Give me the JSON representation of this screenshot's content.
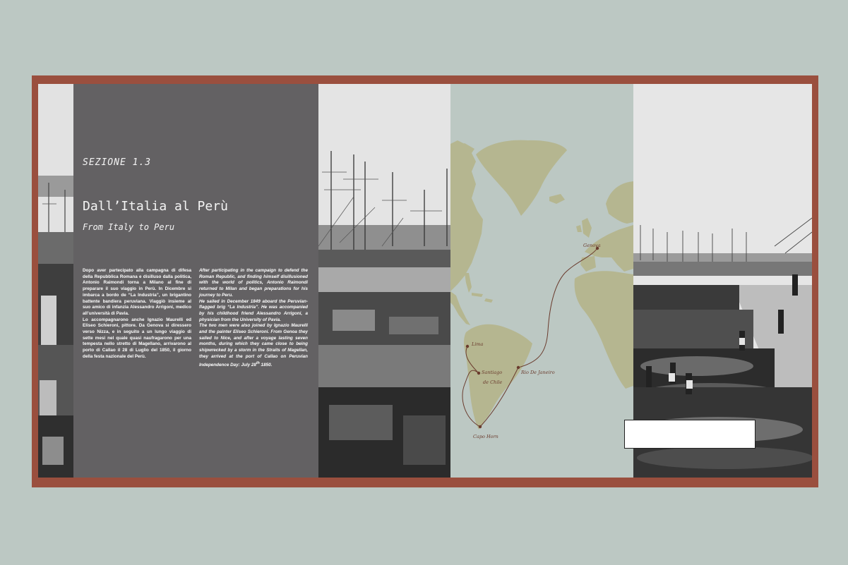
{
  "section": {
    "label": "SEZIONE 1.3",
    "title_it": "Dall’Italia al Perù",
    "title_en": "From Italy to Peru"
  },
  "body_it": {
    "p1": "Dopo aver partecipato alla campagna di difesa della Repubblica Romana e disilluso dalla politica, Antonio Raimondi torna a Milano al fine di preparare il suo viaggio in Perù. In Dicembre si imbarca a bordo de “La Industria”, un brigantino battente bandiera peruviana. Viaggiò insieme al suo amico di infanzia Alessandro Arrigoni, medico all’università di Pavia.",
    "p2": "Lo accompagnarono anche Ignazio Maurelli ed Eliseo Schieroni, pittore. Da Genova si diressero verso Nizza, e in seguito a un lungo viaggio di sette mesi nel quale quasi naufragarono per una tempesta nello stretto di Magellano, arrivarono al porto di Callao il 28 di Luglio del 1850, il giorno della festa nazionale del Perù."
  },
  "body_en": {
    "p1": "After participating in the campaign to defend the Roman Republic, and finding himself disillusioned with the world of politics, Antonio Raimondi returned to Milan and began preparations for his journey to Peru.",
    "p2": "He sailed in December 1849 aboard the Peruvian-flagged brig “La Industria”. He was accompanied by his childhood friend Alessandro Arrigoni, a physician from the University of Pavia.",
    "p3_main": "The two men were also joined by Ignazio Maurelli and the painter Eliseo Schieroni. From Genoa they sailed to Nice, and after a voyage lasting seven months, during which they came close to being shipwrecked by a storm in the Straits of Magellan, they arrived at the port of Callao on Peruvian Independence Day: July 28",
    "p3_sup": "th",
    "p3_end": " 1850."
  },
  "map": {
    "places": {
      "genova": "Genova",
      "lima": "Lima",
      "santiago_1": "Santiago",
      "santiago_2": "de Chile",
      "rio": "Rio De Janeiro",
      "capo_horn": "Capo Horn"
    },
    "colors": {
      "ocean": "#bcc8c3",
      "land": "#b5b690",
      "route": "#6a3b2d"
    }
  },
  "colors": {
    "background": "#bcc8c3",
    "frame": "#9a4f3e",
    "text_panel": "#636163"
  },
  "caption": ""
}
